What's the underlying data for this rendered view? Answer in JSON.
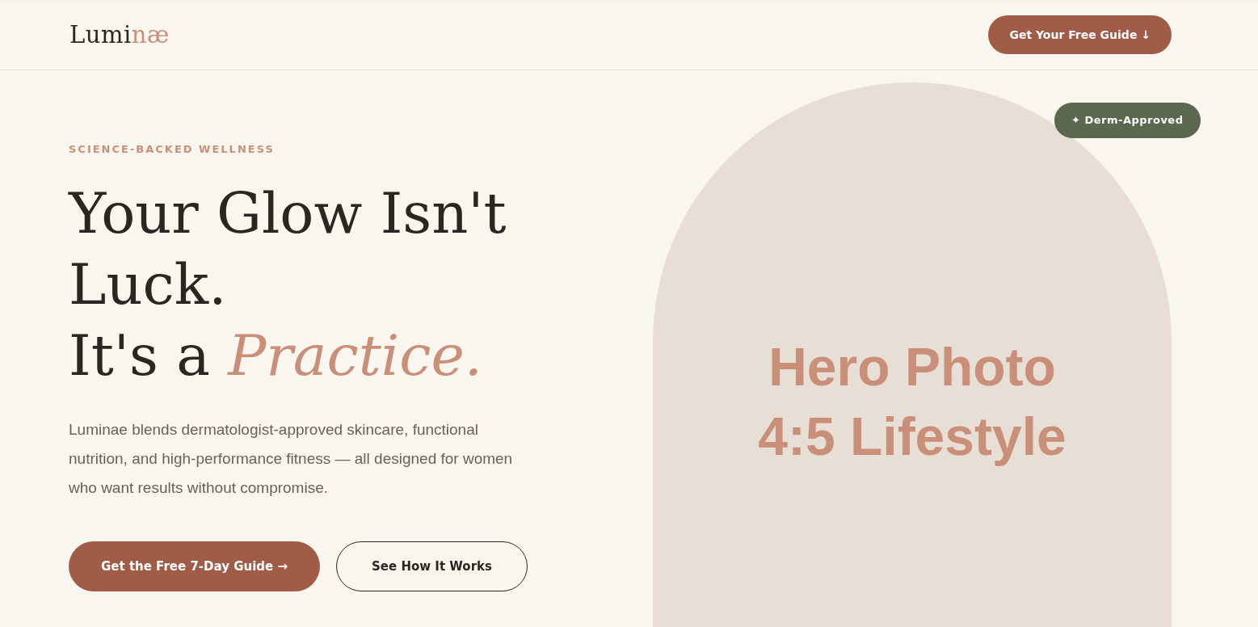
{
  "header": {
    "logo": [
      {
        "text": "Lumi",
        "accent": false
      },
      {
        "text": "næ",
        "accent": true
      }
    ],
    "cta": "Get Your Free Guide ↓"
  },
  "hero": {
    "eyebrow": "SCIENCE-BACKED WELLNESS",
    "headline": [
      "Your Glow Isn't Luck.",
      "It's a *Practice.*"
    ],
    "body": "Luminae blends dermatologist-approved skincare, functional nutrition, and high-performance fitness — all designed for women who want results without compromise.",
    "buttons": [
      {
        "label": "Get the Free 7-Day Guide →",
        "kind": "primary"
      },
      {
        "label": "See How It Works",
        "kind": "outline"
      }
    ],
    "photo": {
      "lines": [
        "Hero Photo",
        "4:5 Lifestyle"
      ]
    },
    "badge": "✦ Derm-Approved"
  }
}
